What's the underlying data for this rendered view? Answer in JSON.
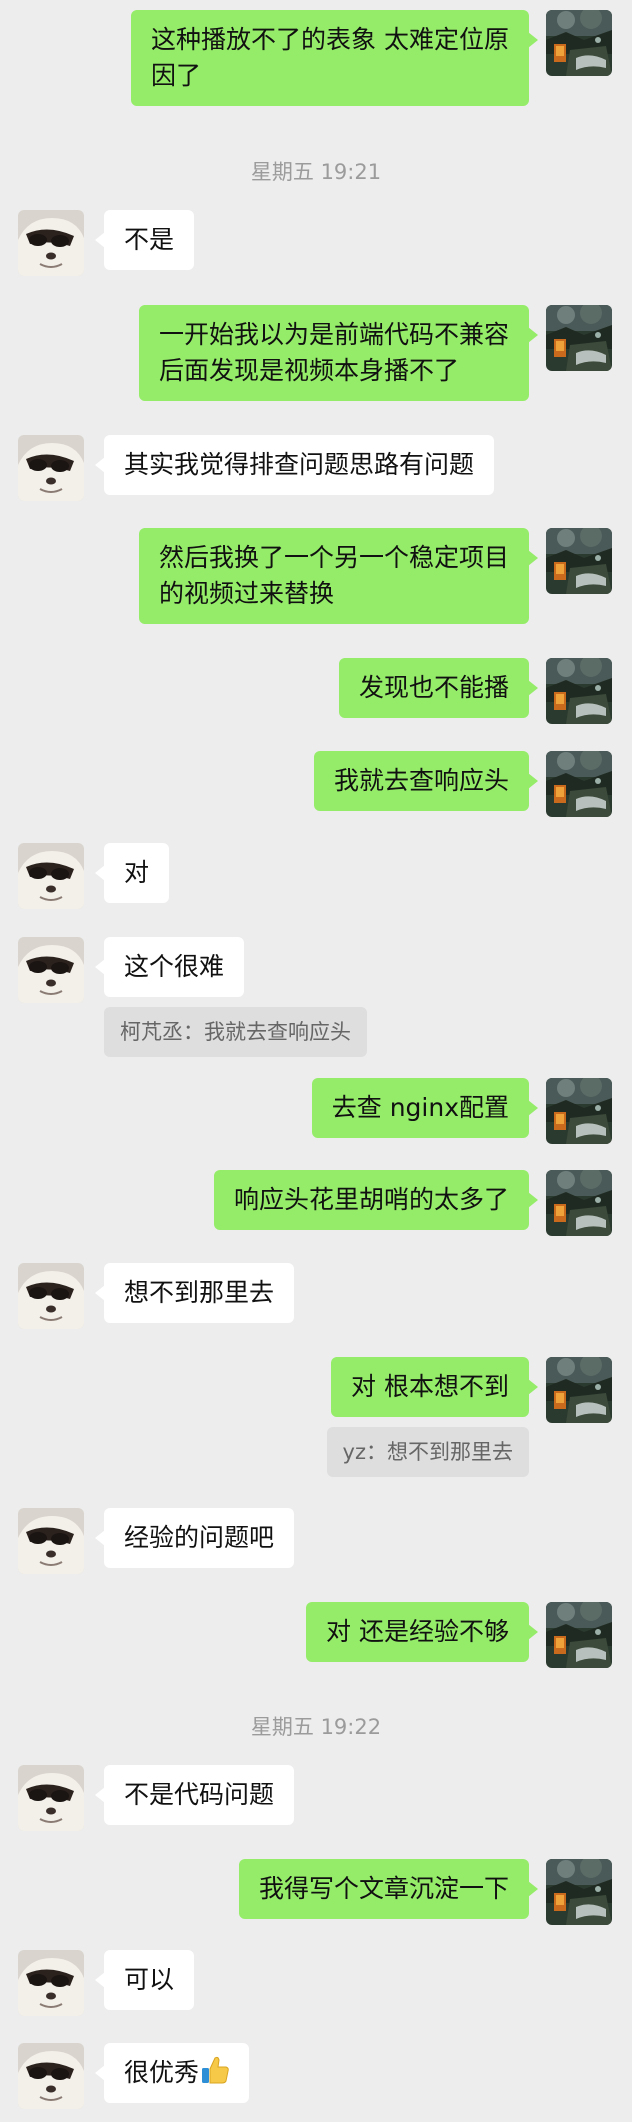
{
  "timestamps": {
    "t1": "星期五 19:21",
    "t2": "星期五 19:22"
  },
  "messages": [
    {
      "id": "m1",
      "side": "me",
      "text": "这种播放不了的表象 太难定位原\n因了"
    },
    {
      "id": "m2",
      "side": "other",
      "text": "不是"
    },
    {
      "id": "m3",
      "side": "me",
      "text": "一开始我以为是前端代码不兼容\n后面发现是视频本身播不了"
    },
    {
      "id": "m4",
      "side": "other",
      "text": "其实我觉得排查问题思路有问题"
    },
    {
      "id": "m5",
      "side": "me",
      "text": "然后我换了一个另一个稳定项目\n的视频过来替换"
    },
    {
      "id": "m6",
      "side": "me",
      "text": "发现也不能播"
    },
    {
      "id": "m7",
      "side": "me",
      "text": "我就去查响应头"
    },
    {
      "id": "m8",
      "side": "other",
      "text": "对"
    },
    {
      "id": "m9",
      "side": "other",
      "text": "这个很难",
      "quote": "柯芃丞：我就去查响应头"
    },
    {
      "id": "m10",
      "side": "me",
      "text": "去查 nginx配置"
    },
    {
      "id": "m11",
      "side": "me",
      "text": "响应头花里胡哨的太多了"
    },
    {
      "id": "m12",
      "side": "other",
      "text": "想不到那里去"
    },
    {
      "id": "m13",
      "side": "me",
      "text": "对 根本想不到",
      "quote": "yz：想不到那里去"
    },
    {
      "id": "m14",
      "side": "other",
      "text": "经验的问题吧"
    },
    {
      "id": "m15",
      "side": "me",
      "text": "对 还是经验不够"
    },
    {
      "id": "m16",
      "side": "other",
      "text": "不是代码问题"
    },
    {
      "id": "m17",
      "side": "me",
      "text": "我得写个文章沉淀一下"
    },
    {
      "id": "m18",
      "side": "other",
      "text": "可以"
    },
    {
      "id": "m19",
      "side": "other",
      "text": "很优秀",
      "emoji": "thumbs-up-icon"
    }
  ],
  "avatars": {
    "me": "avatar-forest-night",
    "other": "avatar-white-dog"
  },
  "colors": {
    "background": "#ededed",
    "my_bubble": "#95ec69",
    "other_bubble": "#ffffff",
    "quote_bg": "#dedede",
    "timestamp": "#9b9b9b"
  }
}
